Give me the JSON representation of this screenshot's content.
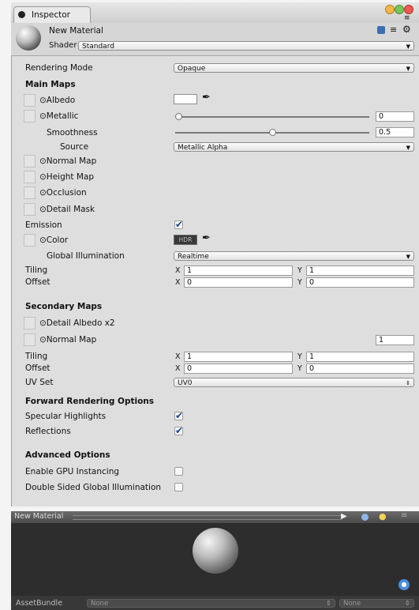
{
  "window": {
    "tab_title": "Inspector"
  },
  "header": {
    "material_name": "New Material",
    "shader_label": "Shader",
    "shader_value": "Standard"
  },
  "rendering_mode": {
    "label": "Rendering Mode",
    "value": "Opaque"
  },
  "main_maps": {
    "title": "Main Maps",
    "albedo": "⊙Albedo",
    "metallic": "⊙Metallic",
    "metallic_value": "0",
    "metallic_fraction": 0.0,
    "smoothness": "Smoothness",
    "smoothness_value": "0.5",
    "smoothness_fraction": 0.5,
    "source_label": "Source",
    "source_value": "Metallic Alpha",
    "normal_map": "⊙Normal Map",
    "height_map": "⊙Height Map",
    "occlusion": "⊙Occlusion",
    "detail_mask": "⊙Detail Mask",
    "emission": "Emission",
    "emission_checked": true,
    "color": "⊙Color",
    "hdr_label": "HDR",
    "global_illumination": "Global Illumination",
    "gi_value": "Realtime",
    "tiling": "Tiling",
    "offset": "Offset",
    "tiling_x": "1",
    "tiling_y": "1",
    "offset_x": "0",
    "offset_y": "0"
  },
  "secondary_maps": {
    "title": "Secondary Maps",
    "detail_albedo": "⊙Detail Albedo x2",
    "normal_map": "⊙Normal Map",
    "normal_value": "1",
    "tiling": "Tiling",
    "offset": "Offset",
    "tiling_x": "1",
    "tiling_y": "1",
    "offset_x": "0",
    "offset_y": "0",
    "uv_set_label": "UV Set",
    "uv_set_value": "UV0"
  },
  "axis": {
    "x": "X",
    "y": "Y"
  },
  "forward_rendering": {
    "title": "Forward Rendering Options",
    "specular": "Specular Highlights",
    "specular_checked": true,
    "reflections": "Reflections",
    "reflections_checked": true
  },
  "advanced": {
    "title": "Advanced Options",
    "gpu_instancing": "Enable GPU Instancing",
    "gpu_checked": false,
    "double_sided": "Double Sided Global Illumination",
    "double_sided_checked": false
  },
  "preview": {
    "title": "New Material"
  },
  "asset_bundle": {
    "label": "AssetBundle",
    "name_value": "None",
    "variant_value": "None"
  },
  "colors": {
    "panel": "#dedede",
    "preview_bg": "#2d2d2d",
    "check": "#1a3f8a",
    "albedo_swatch": "#ffffff",
    "hdr_swatch": "#3a3a3a"
  }
}
